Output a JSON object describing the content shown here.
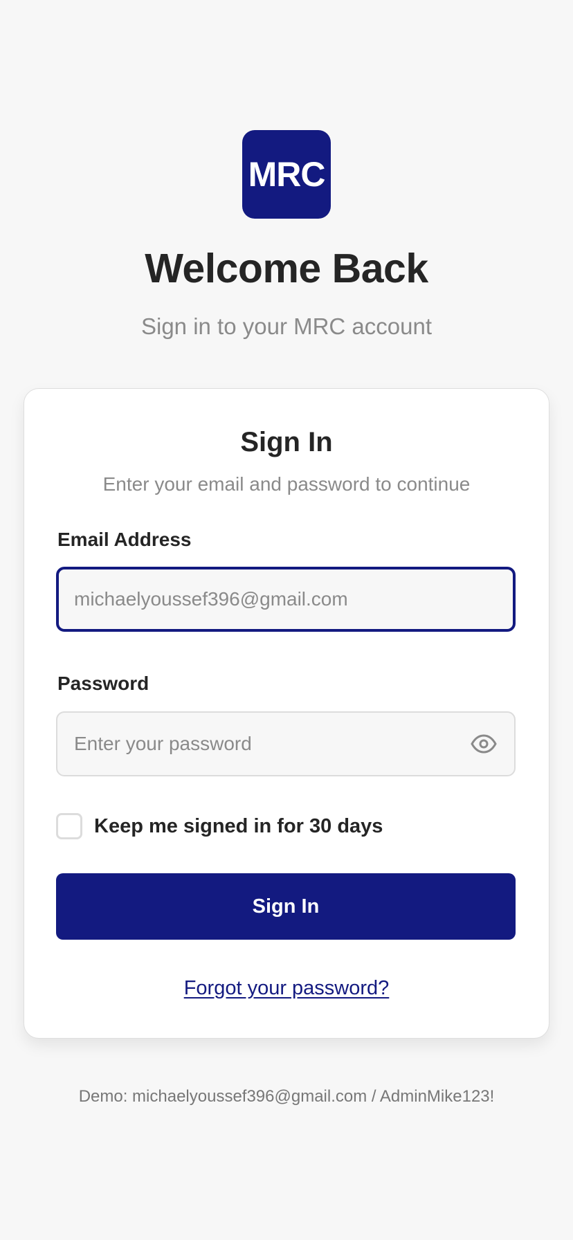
{
  "brand": {
    "logo_text": "MRC",
    "accent_color": "#131a80"
  },
  "header": {
    "title": "Welcome Back",
    "subtitle": "Sign in to your MRC account"
  },
  "signin_card": {
    "title": "Sign In",
    "subtitle": "Enter your email and password to continue",
    "email": {
      "label": "Email Address",
      "value": "michaelyoussef396@gmail.com",
      "placeholder": ""
    },
    "password": {
      "label": "Password",
      "value": "",
      "placeholder": "Enter your password",
      "toggle_icon": "eye-icon"
    },
    "remember_me": {
      "label": "Keep me signed in for 30 days",
      "checked": false
    },
    "submit_label": "Sign In",
    "forgot_password_label": "Forgot your password?"
  },
  "footer": {
    "demo_text": "Demo: michaelyoussef396@gmail.com / AdminMike123!"
  }
}
